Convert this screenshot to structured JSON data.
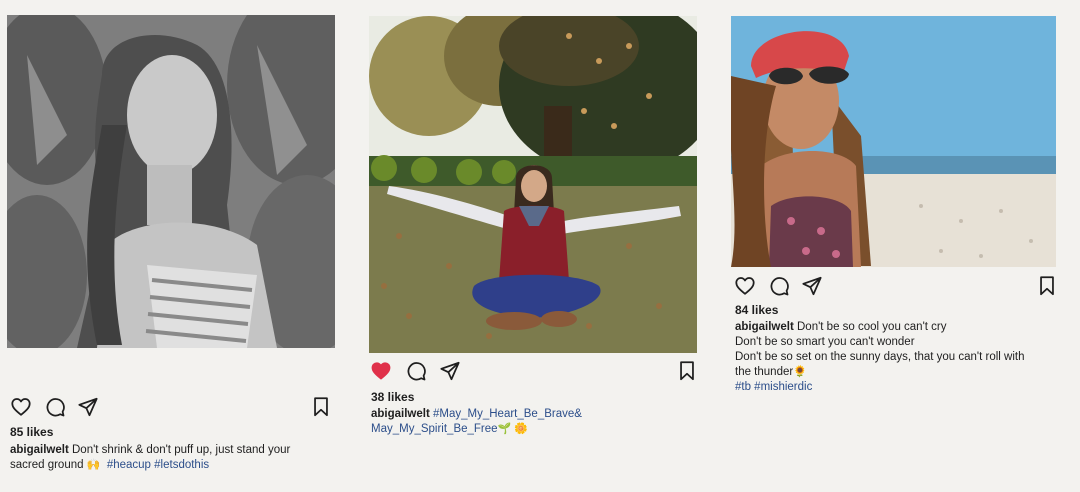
{
  "posts": [
    {
      "likes": "85 likes",
      "username": "abigailwelt",
      "caption_line1": "Don't shrink & don't puff up, just stand your",
      "caption_line2": "sacred ground",
      "emoji": "🙌",
      "hashtags": "#heacup #letsdothis",
      "liked": false
    },
    {
      "likes": "38 likes",
      "username": "abigailwelt",
      "hashtag_line1": "#May_My_Heart_Be_Brave&",
      "hashtag_line2": "May_My_Spirit_Be_Free",
      "emoji": "🌱 🌼",
      "liked": true
    },
    {
      "likes": "84 likes",
      "username": "abigailwelt",
      "caption_line1": "Don't be so cool you can't cry",
      "caption_line2": "Don't be so smart you can't wonder",
      "caption_line3": "Don't be so set on the sunny days, that you can't roll with",
      "caption_line4": "the thunder",
      "emoji": "🌻",
      "hashtags": "#tb #mishierdic",
      "liked": false
    }
  ],
  "colors": {
    "liked_heart": "#e0314a",
    "hashtag": "#2c4e8a",
    "page_background": "#f3f2ef"
  },
  "icons": [
    "heart-icon",
    "comment-icon",
    "share-icon",
    "bookmark-icon"
  ]
}
